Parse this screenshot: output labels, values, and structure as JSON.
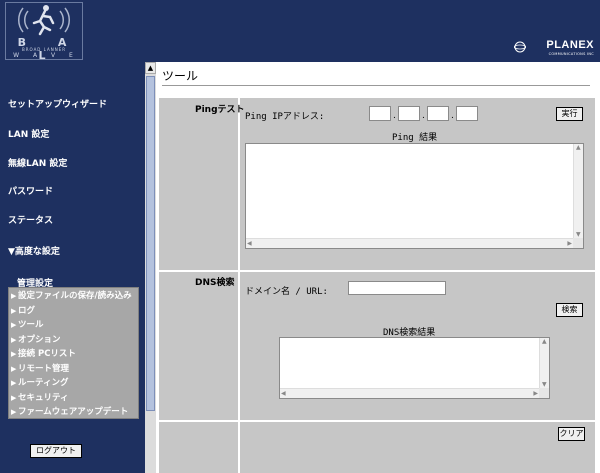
{
  "header": {
    "logo_text": [
      "B A L",
      "BROAD LANNER",
      "W A V E"
    ],
    "brand": "PLANEX",
    "brand_sub": "COMMUNICATIONS INC",
    "bg_color": "#1e3060"
  },
  "sidebar": {
    "items": [
      {
        "label": "セットアップウィザード"
      },
      {
        "label": "LAN 設定"
      },
      {
        "label": "無線LAN 設定"
      },
      {
        "label": "パスワード"
      },
      {
        "label": "ステータス"
      },
      {
        "label": "▼高度な設定"
      }
    ],
    "submenu_title": "管理設定",
    "submenu": [
      "設定ファイルの保存/読み込み",
      "ログ",
      "ツール",
      "オプション",
      "接続 PCリスト",
      "リモート管理",
      "ルーティング",
      "セキュリティ",
      "ファームウェアアップデート"
    ],
    "logout_label": "ログアウト"
  },
  "main": {
    "title": "ツール",
    "ping": {
      "section_label": "Pingテスト",
      "ip_label": "Ping IPアドレス:",
      "ip_octets": [
        "",
        "",
        "",
        ""
      ],
      "run_button": "実行",
      "result_label": "Ping 結果",
      "result_value": ""
    },
    "dns": {
      "section_label": "DNS検索",
      "domain_label": "ドメイン名 / URL:",
      "domain_value": "",
      "search_button": "検索",
      "result_label": "DNS検索結果",
      "result_value": ""
    },
    "clear_button": "クリア"
  }
}
